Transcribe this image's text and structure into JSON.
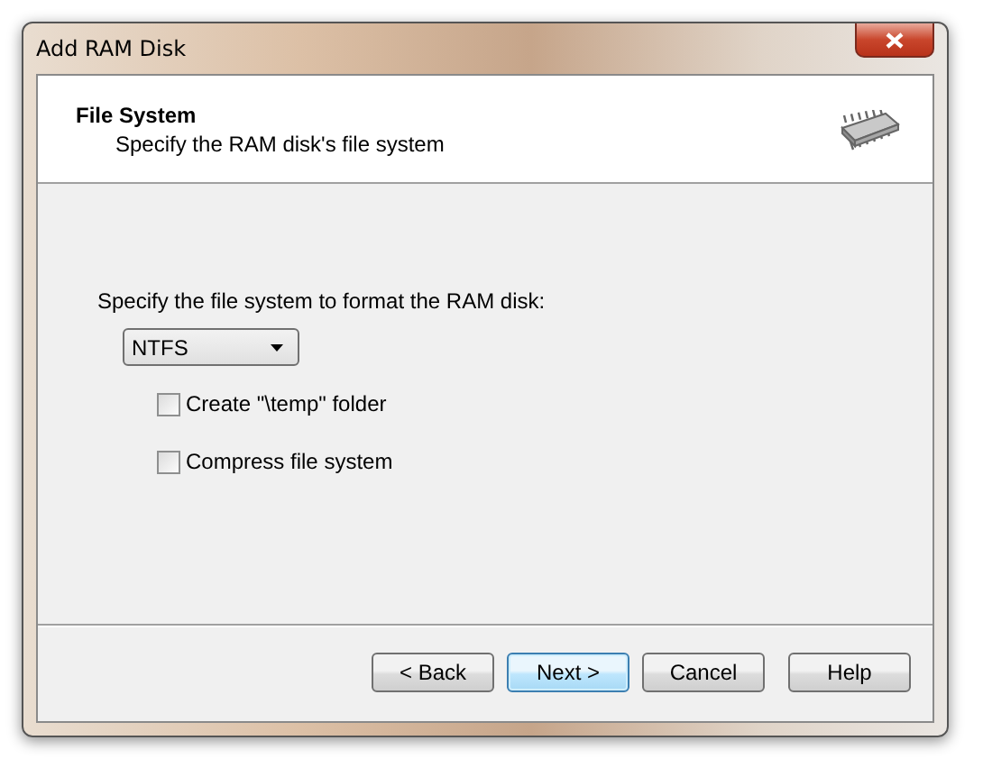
{
  "window": {
    "title": "Add RAM Disk"
  },
  "header": {
    "title": "File System",
    "subtitle": "Specify the RAM disk's file system"
  },
  "prompt": "Specify the file system to format the RAM disk:",
  "file_system": {
    "value": "NTFS"
  },
  "options": [
    {
      "label": "Create \"\\temp\" folder",
      "checked": false
    },
    {
      "label": "Compress file system",
      "checked": false
    }
  ],
  "buttons": [
    {
      "label": "< Back",
      "default": false
    },
    {
      "label": "Next >",
      "default": true
    },
    {
      "label": "Cancel",
      "default": false
    },
    {
      "label": "Help",
      "default": false
    }
  ]
}
